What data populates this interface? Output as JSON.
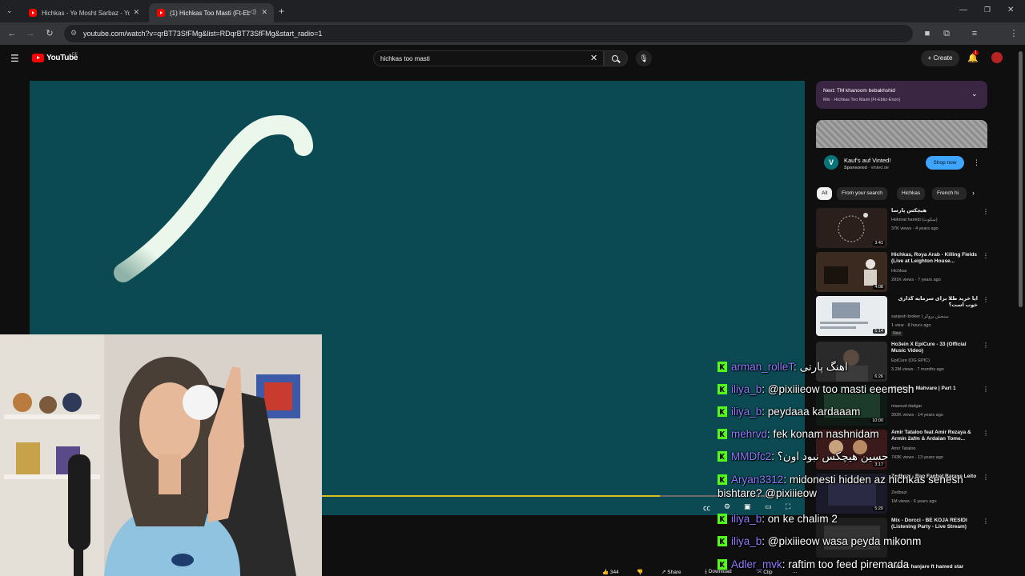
{
  "browser": {
    "tabs": [
      {
        "title": "Hichkas - Ye Mosht Sarbaz - Yo",
        "active": false
      },
      {
        "title": "(1) Hichkas Too Masti (Ft-Eb",
        "active": true
      }
    ],
    "new_tab": "+",
    "url": "youtube.com/watch?v=qrBT73SfFMg&list=RDqrBT73SfFMg&start_radio=1"
  },
  "youtube": {
    "logo": "YouTube",
    "country": "DE",
    "search_value": "hichkas too masti",
    "create_label": "Create",
    "notification_count": "1"
  },
  "player": {
    "progress": 0.7,
    "background_color": "#0b4a52",
    "stroke_color": "#eaf7ea"
  },
  "next_up": {
    "title": "Next: TM khanoom bebakhshid",
    "subtitle": "Mix · Hichkas Too Masti (Ft-Ebliz-Enzo)"
  },
  "ad": {
    "logo_letter": "V",
    "title": "Kauf's auf Vinted!",
    "sponsored": "Sponsored",
    "domain": "vinted.de",
    "cta": "Shop now"
  },
  "chips": [
    "All",
    "From your search",
    "Hichkas",
    "French hi"
  ],
  "recommendations": [
    {
      "title": "هیچکس پارسا",
      "channel": "Hekmat hamidi (سکوت)",
      "meta": "37K views · 4 years ago",
      "duration": "3:41",
      "badge": ""
    },
    {
      "title": "Hichkas, Roya Arab - Killing Fields (Live at Leighton House...",
      "channel": "Hichkas",
      "meta": "291K views · 7 years ago",
      "duration": "4:08",
      "badge": ""
    },
    {
      "title": "آیا خرید طلا برای سرمایه گذاری خوب است؟",
      "channel": "sanjesh broker | سنجش بروکر",
      "meta": "1 view · 8 hours ago",
      "duration": "5:14",
      "badge": "New"
    },
    {
      "title": "Ho3ein X EpiCure - 33 (Official Music Video)",
      "channel": "EpiCure (OG EPIC)",
      "meta": "3.2M views · 7 months ago",
      "duration": "6:26",
      "badge": ""
    },
    {
      "title": "Hichkas - Mahvare | Part 1",
      "channel": "masoud dadgar",
      "meta": "302K views · 14 years ago",
      "duration": "10:00",
      "badge": ""
    },
    {
      "title": "Amir Tataloo feat Amir Rezaya & Armin 2afm & Ardalan Tome...",
      "channel": "Amir Tataloo",
      "meta": "743K views · 13 years ago",
      "duration": "3:17",
      "badge": ""
    },
    {
      "title": "Zedbazi - Rap Faghat Baraye Leito",
      "channel": "Zedbazi",
      "meta": "1M views · 6 years ago",
      "duration": "5:20",
      "badge": ""
    },
    {
      "title": "Mix - Dorcci - BE KOJA RESIDI (Listening Party - Live Stream)",
      "channel": "Mix",
      "meta": "",
      "duration": "",
      "badge": ""
    },
    {
      "title": "matin 2 hanjare ft hamed star",
      "channel": "",
      "meta": "",
      "duration": "",
      "badge": ""
    }
  ],
  "actions": {
    "likes": "344",
    "share": "Share",
    "download": "Download",
    "clip": "Clip",
    "more": "..."
  },
  "chat": [
    {
      "user": "arman_rolleT",
      "message": "اهنگ پارتی"
    },
    {
      "user": "iliya_b",
      "message": "@pixiiieow too masti eeemesh"
    },
    {
      "user": "iliya_b",
      "message": "peydaaa kardaaam"
    },
    {
      "user": "mehrvd",
      "message": "fek konam nashnidam"
    },
    {
      "user": "MMDfc2",
      "message": "حسین هیچکس نبود اون؟"
    },
    {
      "user": "Aryan3312",
      "message": "midonesti hidden az hichkas senesh bishtare? @pixiiieow"
    },
    {
      "user": "iliya_b",
      "message": "on ke chalim 2"
    },
    {
      "user": "iliya_b",
      "message": "@pixiiieow wasa peyda mikonm"
    },
    {
      "user": "Adler_mvk",
      "message": "raftim too feed piremarda"
    }
  ]
}
